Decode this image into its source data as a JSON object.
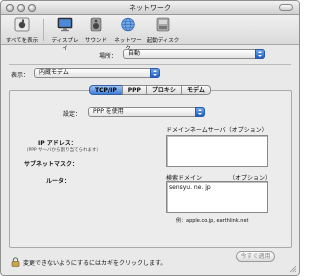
{
  "window": {
    "title": "ネットワーク"
  },
  "toolbar": {
    "items": [
      {
        "label": "すべてを表示",
        "icon": "apple-panel-icon"
      },
      {
        "label": "ディスプレイ",
        "icon": "display-icon"
      },
      {
        "label": "サウンド",
        "icon": "speaker-icon"
      },
      {
        "label": "ネットワーク",
        "icon": "network-globe-icon"
      },
      {
        "label": "起動ディスク",
        "icon": "startup-disk-icon"
      }
    ]
  },
  "location": {
    "label": "場所：",
    "value": "自動"
  },
  "show": {
    "label": "表示：",
    "value": "内蔵モデム"
  },
  "tabs": [
    {
      "label": "TCP/IP",
      "active": true
    },
    {
      "label": "PPP",
      "active": false
    },
    {
      "label": "プロキシ",
      "active": false
    },
    {
      "label": "モデム",
      "active": false
    }
  ],
  "tcpip": {
    "config_label": "設定：",
    "config_value": "PPP を使用",
    "ip_label": "IP アドレス：",
    "ip_note": "（PPP サーバから割り当てられます）",
    "subnet_label": "サブネットマスク：",
    "router_label": "ルータ：",
    "dns_label": "ドメインネームサーバ",
    "dns_optional": "（オプション）",
    "dns_value": "",
    "search_label": "検索ドメイン",
    "search_optional": "（オプション）",
    "search_value": "sensyu. ne. jp",
    "example_text": "例：apple.co.jp, earthlink.net"
  },
  "footer": {
    "lock_text": "変更できないようにするにはカギをクリックします。",
    "apply_label": "今すぐ適用"
  },
  "colors": {
    "accent": "#3f7fd6",
    "window_bg": "#e9e9e9"
  }
}
